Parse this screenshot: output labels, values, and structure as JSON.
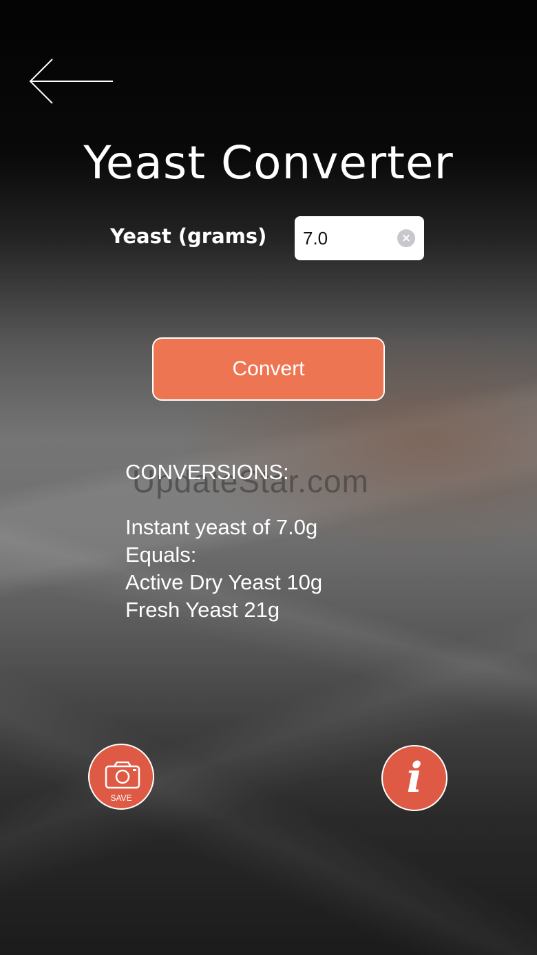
{
  "app": {
    "title": "Yeast Converter"
  },
  "back": {
    "icon": "arrow-left-icon"
  },
  "input": {
    "label": "Yeast (grams)",
    "value": "7.0",
    "clear_icon": "clear-circle-icon"
  },
  "convert": {
    "label": "Convert",
    "color": "#ee7552"
  },
  "results": {
    "heading": "CONVERSIONS:",
    "lines": [
      "Instant yeast of 7.0g",
      "Equals:",
      "Active Dry Yeast 10g",
      "Fresh Yeast  21g"
    ]
  },
  "watermark": "UpdateStar.com",
  "save": {
    "label": "SAVE",
    "icon": "camera-icon",
    "color": "#de5a44"
  },
  "info": {
    "glyph": "i",
    "icon": "info-icon"
  }
}
